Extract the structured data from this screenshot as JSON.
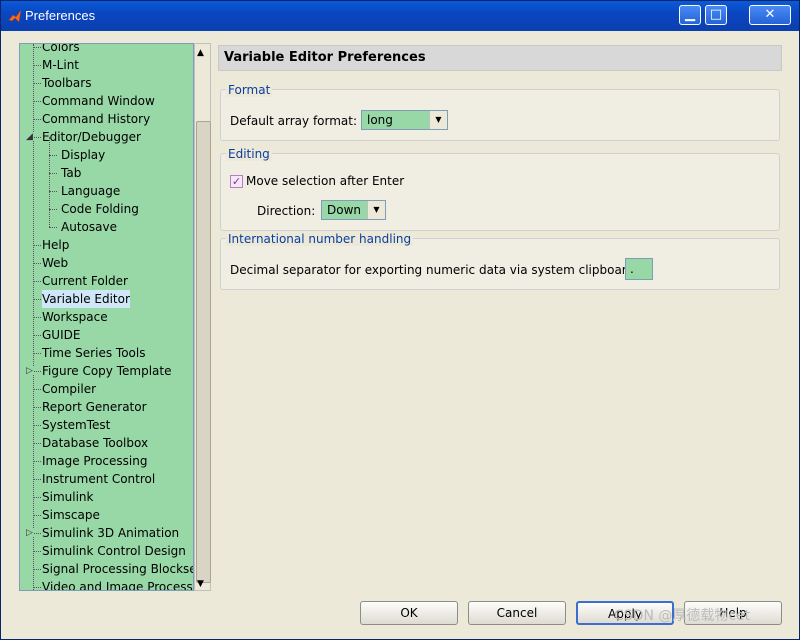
{
  "window": {
    "title": "Preferences",
    "minimize_glyph": "▁",
    "maximize_glyph": "□",
    "close_glyph": "✕"
  },
  "tree": {
    "items": [
      {
        "label": "Colors",
        "level": 0
      },
      {
        "label": "M-Lint",
        "level": 0
      },
      {
        "label": "Toolbars",
        "level": 0
      },
      {
        "label": "Command Window",
        "level": 0
      },
      {
        "label": "Command History",
        "level": 0
      },
      {
        "label": "Editor/Debugger",
        "level": 0,
        "expander": "◢"
      },
      {
        "label": "Display",
        "level": 1
      },
      {
        "label": "Tab",
        "level": 1
      },
      {
        "label": "Language",
        "level": 1
      },
      {
        "label": "Code Folding",
        "level": 1
      },
      {
        "label": "Autosave",
        "level": 1
      },
      {
        "label": "Help",
        "level": 0
      },
      {
        "label": "Web",
        "level": 0
      },
      {
        "label": "Current Folder",
        "level": 0
      },
      {
        "label": "Variable Editor",
        "level": 0,
        "selected": true
      },
      {
        "label": "Workspace",
        "level": 0
      },
      {
        "label": "GUIDE",
        "level": 0
      },
      {
        "label": "Time Series Tools",
        "level": 0
      },
      {
        "label": "Figure Copy Template",
        "level": 0,
        "expander": "▷"
      },
      {
        "label": "Compiler",
        "level": 0
      },
      {
        "label": "Report Generator",
        "level": 0
      },
      {
        "label": "SystemTest",
        "level": 0
      },
      {
        "label": "Database Toolbox",
        "level": 0
      },
      {
        "label": "Image Processing",
        "level": 0
      },
      {
        "label": "Instrument Control",
        "level": 0
      },
      {
        "label": "Simulink",
        "level": 0
      },
      {
        "label": "Simscape",
        "level": 0
      },
      {
        "label": "Simulink 3D Animation",
        "level": 0,
        "expander": "▷"
      },
      {
        "label": "Simulink Control Design",
        "level": 0
      },
      {
        "label": "Signal Processing Blockset",
        "level": 0
      },
      {
        "label": "Video and Image Processir",
        "level": 0
      }
    ]
  },
  "panel": {
    "title": "Variable Editor Preferences",
    "format": {
      "title": "Format",
      "array_format_label": "Default array format:",
      "array_format_value": "long"
    },
    "editing": {
      "title": "Editing",
      "move_selection_label": "Move selection after Enter",
      "move_selection_checked": true,
      "check_glyph": "✓",
      "direction_label": "Direction:",
      "direction_value": "Down"
    },
    "intl": {
      "title": "International number handling",
      "decimal_label": "Decimal separator for exporting numeric data via system clipboard:",
      "decimal_value": "."
    }
  },
  "buttons": {
    "ok": "OK",
    "cancel": "Cancel",
    "apply": "Apply",
    "help": "Help"
  },
  "watermark": "CSDN @厚德载物cet",
  "colors": {
    "tree_bg": "#98d7a6",
    "title_blue": "#0a4bc4",
    "group_title": "#0a3ea0"
  }
}
